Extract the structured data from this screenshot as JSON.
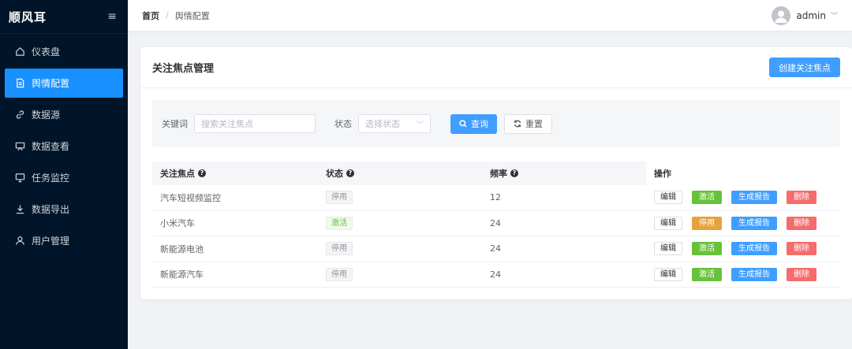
{
  "sidebar": {
    "brand": "顺风耳",
    "menu_icon": "hamburger-icon",
    "items": [
      {
        "label": "仪表盘",
        "icon": "home-icon",
        "active": false
      },
      {
        "label": "舆情配置",
        "icon": "document-icon",
        "active": true
      },
      {
        "label": "数据源",
        "icon": "link-icon",
        "active": false
      },
      {
        "label": "数据查看",
        "icon": "presentation-icon",
        "active": false
      },
      {
        "label": "任务监控",
        "icon": "monitor-icon",
        "active": false
      },
      {
        "label": "数据导出",
        "icon": "download-icon",
        "active": false
      },
      {
        "label": "用户管理",
        "icon": "user-icon",
        "active": false
      }
    ]
  },
  "header": {
    "breadcrumb": {
      "home": "首页",
      "separator": "/",
      "current": "舆情配置"
    },
    "user": {
      "name": "admin"
    }
  },
  "card": {
    "title": "关注焦点管理",
    "create_button": "创建关注焦点"
  },
  "filter": {
    "keyword_label": "关键词",
    "keyword_placeholder": "搜索关注焦点",
    "status_label": "状态",
    "status_placeholder": "选择状态",
    "query_button": "查询",
    "reset_button": "重置"
  },
  "table": {
    "headers": {
      "focus": "关注焦点",
      "status": "状态",
      "frequency": "频率",
      "actions": "操作"
    },
    "actions": {
      "edit": "编辑",
      "activate": "激活",
      "stop": "停用",
      "report": "生成报告",
      "delete": "删除"
    },
    "rows": [
      {
        "focus": "汽车短视频监控",
        "status": "停用",
        "status_active": false,
        "frequency": "12",
        "toggle_label": "激活"
      },
      {
        "focus": "小米汽车",
        "status": "激活",
        "status_active": true,
        "frequency": "24",
        "toggle_label": "停用"
      },
      {
        "focus": "新能源电池",
        "status": "停用",
        "status_active": false,
        "frequency": "24",
        "toggle_label": "激活"
      },
      {
        "focus": "新能源汽车",
        "status": "停用",
        "status_active": false,
        "frequency": "24",
        "toggle_label": "激活"
      }
    ]
  },
  "colors": {
    "sidebar_bg": "#001529",
    "primary": "#409eff",
    "success": "#67c23a",
    "warning": "#e6a23c",
    "danger": "#f56c6c"
  }
}
